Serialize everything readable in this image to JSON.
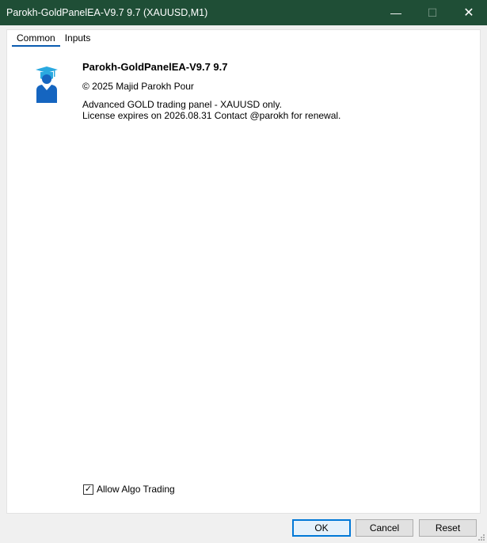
{
  "window": {
    "title": "Parokh-GoldPanelEA-V9.7 9.7 (XAUUSD,M1)",
    "controls": {
      "minimize": "—",
      "maximize": "☐",
      "close": "✕"
    }
  },
  "tabs": [
    {
      "label": "Common",
      "active": true
    },
    {
      "label": "Inputs",
      "active": false
    }
  ],
  "expert": {
    "icon": "graduate-user-icon",
    "name": "Parokh-GoldPanelEA-V9.7 9.7",
    "copyright": "© 2025 Majid Parokh Pour",
    "description_line1": "Advanced GOLD trading panel - XAUUSD only.",
    "description_line2": "License expires on 2026.08.31 Contact @parokh for renewal."
  },
  "options": {
    "allow_algo_trading": {
      "label": "Allow Algo Trading",
      "checked": true,
      "mark": "✓"
    }
  },
  "buttons": {
    "ok": "OK",
    "cancel": "Cancel",
    "reset": "Reset"
  },
  "colors": {
    "titlebar": "#1f4e36",
    "accent": "#0078d7",
    "icon_blue": "#1565c0",
    "icon_cap": "#2aa9e0"
  }
}
